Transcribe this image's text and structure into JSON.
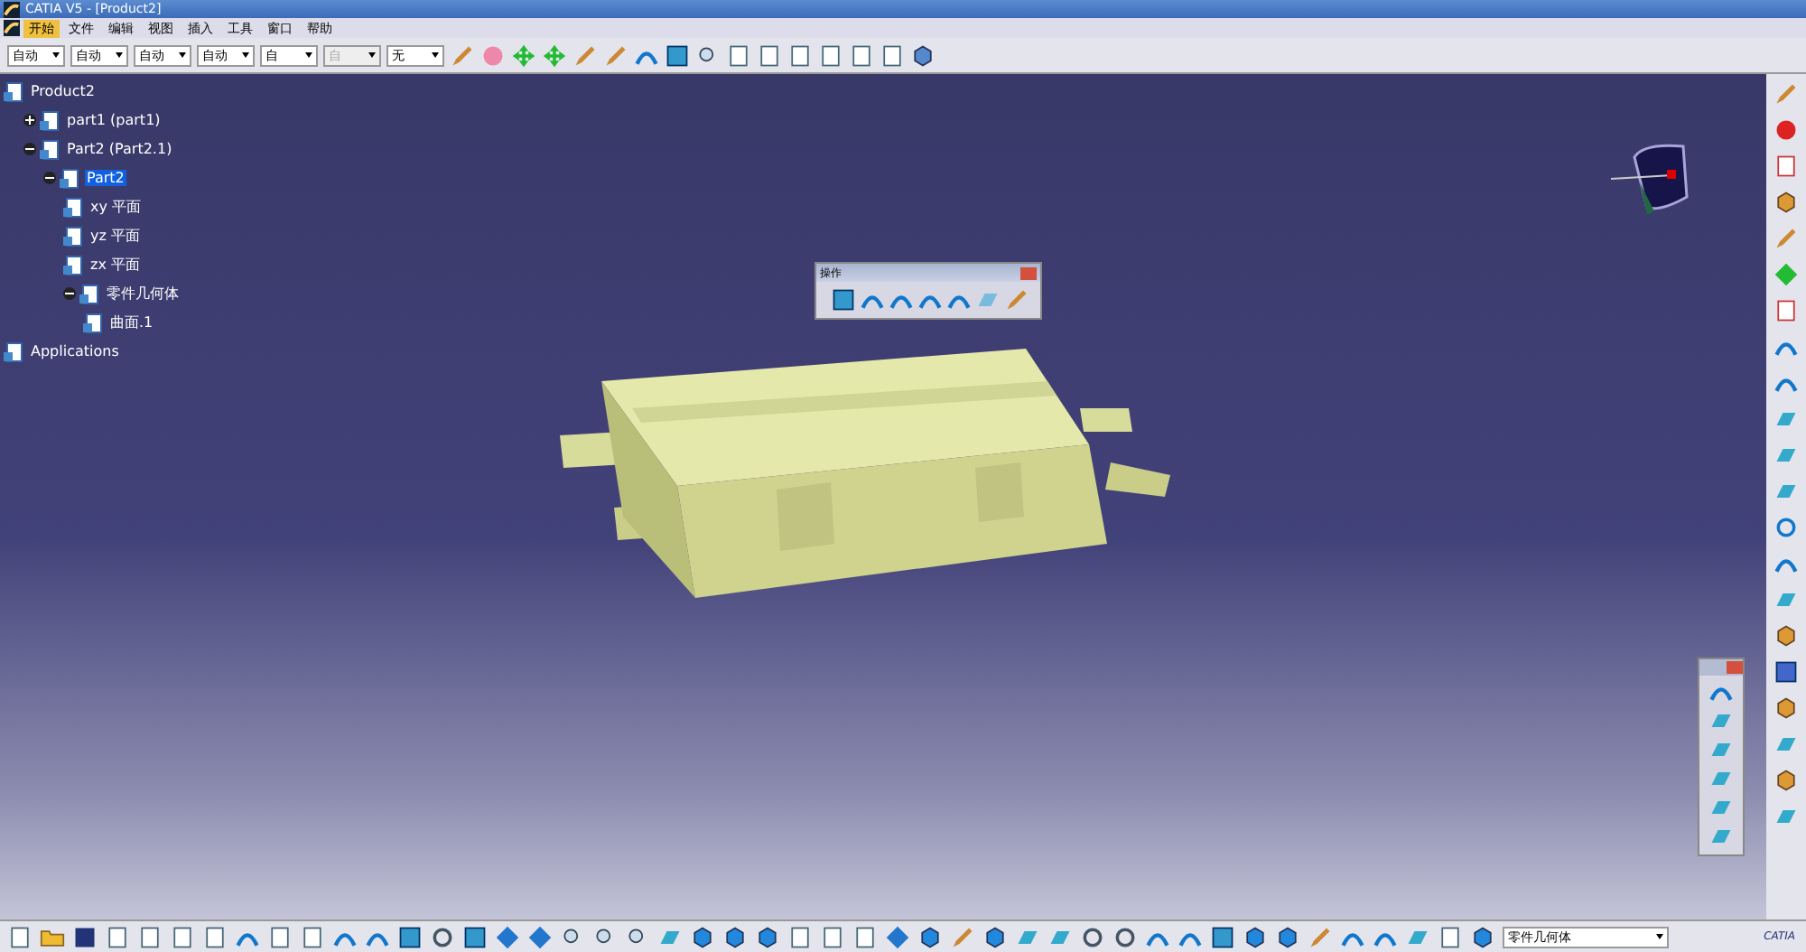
{
  "window": {
    "title": "CATIA V5 - [Product2]"
  },
  "menu": [
    {
      "label": "开始",
      "selected": true
    },
    {
      "label": "文件",
      "selected": false
    },
    {
      "label": "编辑",
      "selected": false
    },
    {
      "label": "视图",
      "selected": false
    },
    {
      "label": "插入",
      "selected": false
    },
    {
      "label": "工具",
      "selected": false
    },
    {
      "label": "窗口",
      "selected": false
    },
    {
      "label": "帮助",
      "selected": false
    }
  ],
  "toolbar_dropdowns": [
    {
      "value": "自动",
      "disabled": false
    },
    {
      "value": "自动",
      "disabled": false
    },
    {
      "value": "自动",
      "disabled": false
    },
    {
      "value": "自动",
      "disabled": false
    },
    {
      "value": "自",
      "disabled": false
    },
    {
      "value": "自",
      "disabled": true
    },
    {
      "value": "无",
      "disabled": false
    }
  ],
  "tree": [
    {
      "label": "Product2",
      "selected": false,
      "children": [
        {
          "label": "part1 (part1)",
          "selected": false,
          "expanded": false
        },
        {
          "label": "Part2 (Part2.1)",
          "selected": false,
          "expanded": true,
          "children": [
            {
              "label": "Part2",
              "selected": true,
              "expanded": true,
              "children": [
                {
                  "label": "xy 平面",
                  "selected": false
                },
                {
                  "label": "yz 平面",
                  "selected": false
                },
                {
                  "label": "zx 平面",
                  "selected": false
                },
                {
                  "label": "零件几何体",
                  "selected": false,
                  "expanded": true,
                  "children": [
                    {
                      "label": "曲面.1",
                      "selected": false
                    }
                  ]
                }
              ]
            }
          ]
        }
      ]
    },
    {
      "label": "Applications",
      "selected": false
    }
  ],
  "operations_toolbar": {
    "title": "操作"
  },
  "status_bar": {
    "body_dropdown": "零件几何体",
    "logo": "CATIA"
  }
}
